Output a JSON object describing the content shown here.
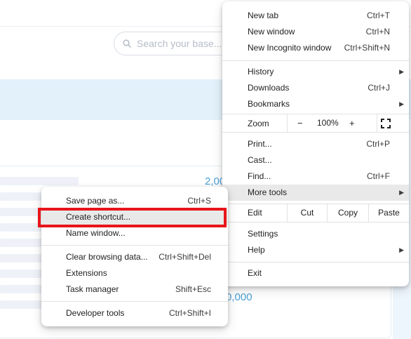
{
  "background": {
    "search_placeholder": "Search your base...",
    "numbers": [
      "2,00",
      "0,000"
    ]
  },
  "main_menu": {
    "new_tab": {
      "label": "New tab",
      "shortcut": "Ctrl+T"
    },
    "new_window": {
      "label": "New window",
      "shortcut": "Ctrl+N"
    },
    "new_incognito": {
      "label": "New Incognito window",
      "shortcut": "Ctrl+Shift+N"
    },
    "history": {
      "label": "History"
    },
    "downloads": {
      "label": "Downloads",
      "shortcut": "Ctrl+J"
    },
    "bookmarks": {
      "label": "Bookmarks"
    },
    "zoom": {
      "label": "Zoom",
      "minus": "−",
      "value": "100%",
      "plus": "+",
      "fullscreen_icon": "fullscreen-icon"
    },
    "print": {
      "label": "Print...",
      "shortcut": "Ctrl+P"
    },
    "cast": {
      "label": "Cast..."
    },
    "find": {
      "label": "Find...",
      "shortcut": "Ctrl+F"
    },
    "more_tools": {
      "label": "More tools"
    },
    "edit": {
      "label": "Edit",
      "cut": "Cut",
      "copy": "Copy",
      "paste": "Paste"
    },
    "settings": {
      "label": "Settings"
    },
    "help": {
      "label": "Help"
    },
    "exit": {
      "label": "Exit"
    }
  },
  "sub_menu": {
    "save_page": {
      "label": "Save page as...",
      "shortcut": "Ctrl+S"
    },
    "create_shortcut": {
      "label": "Create shortcut..."
    },
    "name_window": {
      "label": "Name window..."
    },
    "clear_data": {
      "label": "Clear browsing data...",
      "shortcut": "Ctrl+Shift+Del"
    },
    "extensions": {
      "label": "Extensions"
    },
    "task_manager": {
      "label": "Task manager",
      "shortcut": "Shift+Esc"
    },
    "dev_tools": {
      "label": "Developer tools",
      "shortcut": "Ctrl+Shift+I"
    }
  },
  "colors": {
    "highlight_border": "#e8151b",
    "hover_bg": "#e9e9e9",
    "accent_number": "#4aa0d8"
  }
}
